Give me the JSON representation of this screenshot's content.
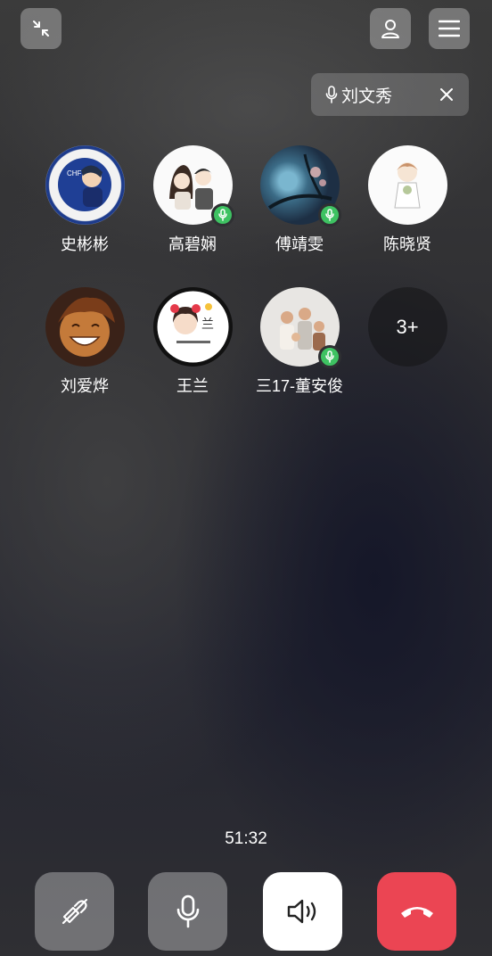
{
  "top_bar": {
    "minimize_icon": "collapse-arrows-icon",
    "contact_icon": "person-icon",
    "menu_icon": "hamburger-menu-icon"
  },
  "active_speaker": {
    "name": "刘文秀",
    "mic_icon": "microphone-icon",
    "close_icon": "close-icon"
  },
  "members": [
    {
      "name": "史彬彬",
      "speaking": false
    },
    {
      "name": "高碧娴",
      "speaking": true
    },
    {
      "name": "傅靖雯",
      "speaking": true
    },
    {
      "name": "陈晓贤",
      "speaking": false
    },
    {
      "name": "刘爱烨",
      "speaking": false
    },
    {
      "name": "王兰",
      "speaking": false
    },
    {
      "name": "三17-董安俊",
      "speaking": true
    }
  ],
  "more_count": "3+",
  "call_timer": "51:32",
  "controls": {
    "effects_icon": "magic-wand-off-icon",
    "mic_icon": "microphone-icon",
    "speaker_icon": "speaker-icon",
    "hangup_icon": "hang-up-icon"
  },
  "colors": {
    "speaking_badge": "#3ec262",
    "hangup": "#eb4553"
  }
}
